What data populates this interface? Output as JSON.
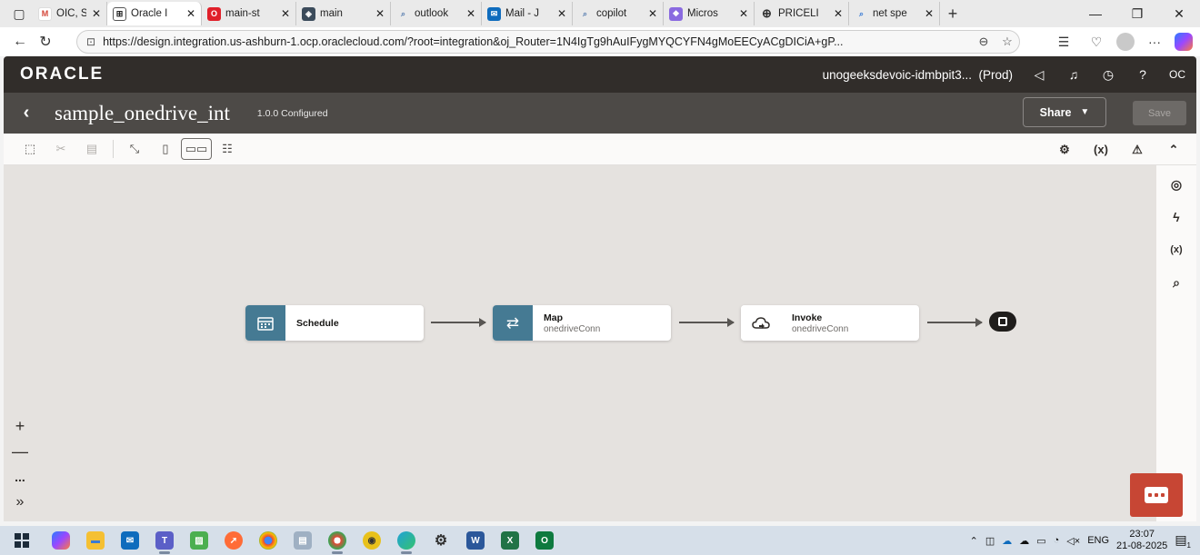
{
  "browser": {
    "tabs": [
      {
        "label": "OIC, SF",
        "fav_color": "#d44638",
        "fav_glyph": "M",
        "active": false
      },
      {
        "label": "Oracle I",
        "fav_color": "#312d2a",
        "fav_glyph": "⊞",
        "active": true
      },
      {
        "label": "main-st",
        "fav_color": "#e0202a",
        "fav_glyph": "O",
        "active": false
      },
      {
        "label": "main",
        "fav_color": "#3b4b5b",
        "fav_glyph": "◈",
        "active": false
      },
      {
        "label": "outlook",
        "fav_color": "#7a9cc6",
        "fav_glyph": "⌕",
        "active": false
      },
      {
        "label": "Mail - J",
        "fav_color": "#0f6cbd",
        "fav_glyph": "✉",
        "active": false
      },
      {
        "label": "copilot",
        "fav_color": "#7a9cc6",
        "fav_glyph": "⌕",
        "active": false
      },
      {
        "label": "Micros",
        "fav_color": "#8a6ae0",
        "fav_glyph": "❖",
        "active": false
      },
      {
        "label": "PRICELI",
        "fav_color": "#555555",
        "fav_glyph": "⊕",
        "active": false
      },
      {
        "label": "net spe",
        "fav_color": "#3a7bd5",
        "fav_glyph": "⌕",
        "active": false
      }
    ],
    "url": "https://design.integration.us-ashburn-1.ocp.oraclecloud.com/?root=integration&oj_Router=1N4IgTg9hAuIFygMYQCYFN4gMoEECyACgDICiA+gP..."
  },
  "app_header": {
    "logo": "ORACLE",
    "instance": "unogeeksdevoic-idmbpit3...",
    "env": "(Prod)",
    "user_initials": "OC"
  },
  "integration": {
    "name": "sample_onedrive_int",
    "version_status": "1.0.0 Configured",
    "share_label": "Share",
    "save_label": "Save"
  },
  "toolbar_right": {
    "variables_label": "(x)"
  },
  "right_rail": {
    "variables_label": "(x)"
  },
  "flow": {
    "nodes": [
      {
        "title": "Schedule",
        "subtitle": "",
        "icon": "calendar-icon"
      },
      {
        "title": "Map",
        "subtitle": "onedriveConn",
        "icon": "map-arrows-icon"
      },
      {
        "title": "Invoke",
        "subtitle": "onedriveConn",
        "icon": "cloud-invoke-icon"
      }
    ]
  },
  "zoom_controls": {
    "more": "..."
  },
  "taskbar": {
    "language": "ENG",
    "time": "23:07",
    "date": "21-08-2025",
    "notification_count": "1"
  }
}
